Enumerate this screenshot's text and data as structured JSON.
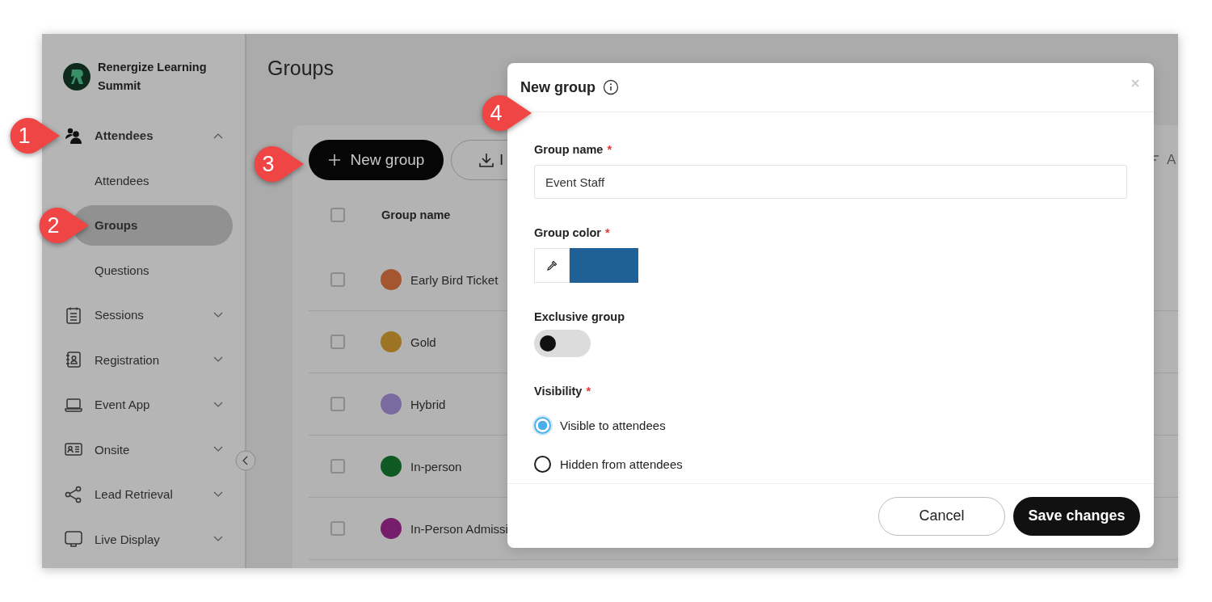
{
  "app": {
    "name": "Renergize Learning Summit"
  },
  "sidebar": {
    "items": [
      {
        "label": "Attendees",
        "expanded": true,
        "children": [
          {
            "label": "Attendees",
            "selected": false
          },
          {
            "label": "Groups",
            "selected": true
          },
          {
            "label": "Questions",
            "selected": false
          }
        ]
      },
      {
        "label": "Sessions",
        "expanded": false
      },
      {
        "label": "Registration",
        "expanded": false
      },
      {
        "label": "Event App",
        "expanded": false
      },
      {
        "label": "Onsite",
        "expanded": false
      },
      {
        "label": "Lead Retrieval",
        "expanded": false
      },
      {
        "label": "Live Display",
        "expanded": false
      }
    ]
  },
  "page": {
    "title": "Groups"
  },
  "toolbar": {
    "new_button": "New group",
    "import_button": "I",
    "trailing_text": "A"
  },
  "table": {
    "columns": [
      "Group name"
    ],
    "select_all_checked": false,
    "rows": [
      {
        "name": "Early Bird Ticket",
        "color": "#a3562f",
        "checked": false
      },
      {
        "name": "Gold",
        "color": "#9c7424",
        "checked": false
      },
      {
        "name": "Hybrid",
        "color": "#7a6aa0",
        "checked": false
      },
      {
        "name": "In-person",
        "color": "#0f5a22",
        "checked": false
      },
      {
        "name": "In-Person Admissi",
        "color": "#761e6c",
        "checked": false
      }
    ]
  },
  "modal": {
    "title": "New group",
    "group_name": {
      "label": "Group name",
      "required_mark": "*",
      "value": "Event Staff"
    },
    "group_color": {
      "label": "Group color",
      "required_mark": "*",
      "color": "#1f6196"
    },
    "exclusive": {
      "label": "Exclusive group",
      "on": false
    },
    "visibility": {
      "label": "Visibility",
      "required_mark": "*",
      "options": [
        {
          "label": "Visible to attendees",
          "selected": true
        },
        {
          "label": "Hidden from attendees",
          "selected": false
        }
      ]
    },
    "buttons": {
      "cancel": "Cancel",
      "save": "Save changes"
    }
  },
  "callouts": [
    {
      "label": "1"
    },
    {
      "label": "2"
    },
    {
      "label": "3"
    },
    {
      "label": "4"
    }
  ]
}
